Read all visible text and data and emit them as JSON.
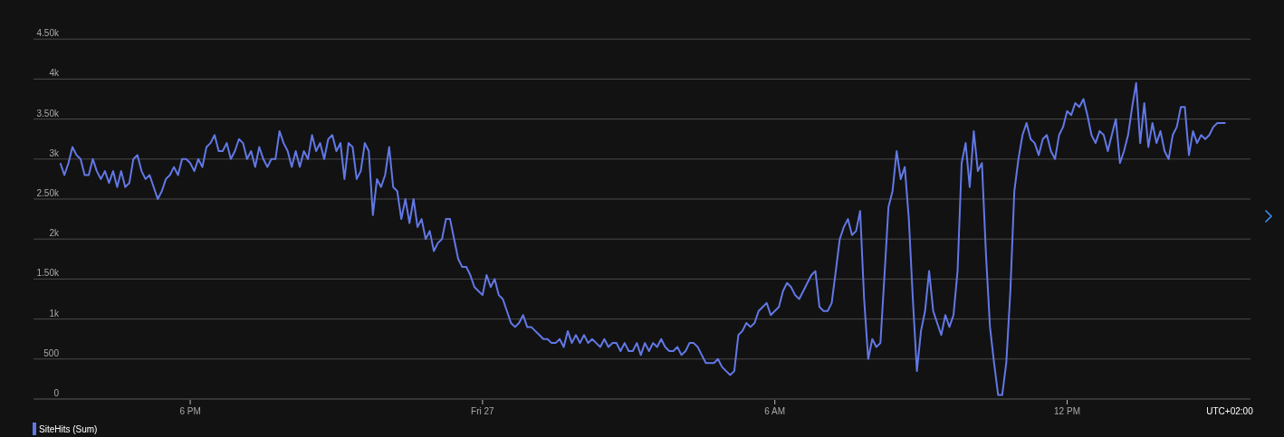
{
  "chart": {
    "timezone": "UTC+02:00",
    "chart_data": {
      "type": "line",
      "categories": [
        null,
        null,
        null,
        null,
        null,
        null,
        null,
        null,
        null,
        null,
        null,
        null,
        null,
        null,
        null,
        null,
        null,
        null,
        null,
        null,
        null,
        null,
        null,
        null,
        null,
        null,
        null,
        null,
        null,
        null,
        null,
        null,
        "6 PM",
        null,
        null,
        null,
        null,
        null,
        null,
        null,
        null,
        null,
        null,
        null,
        null,
        null,
        null,
        null,
        null,
        null,
        null,
        null,
        null,
        null,
        null,
        null,
        null,
        null,
        null,
        null,
        null,
        null,
        null,
        null,
        null,
        null,
        null,
        null,
        null,
        null,
        null,
        null,
        null,
        null,
        null,
        null,
        null,
        null,
        null,
        null,
        null,
        null,
        null,
        null,
        null,
        null,
        null,
        null,
        null,
        null,
        null,
        null,
        null,
        null,
        null,
        null,
        null,
        null,
        null,
        null,
        null,
        null,
        null,
        null,
        "Fri 27",
        null,
        null,
        null,
        null,
        null,
        null,
        null,
        null,
        null,
        null,
        null,
        null,
        null,
        null,
        null,
        null,
        null,
        null,
        null,
        null,
        null,
        null,
        null,
        null,
        null,
        null,
        null,
        null,
        null,
        null,
        null,
        null,
        null,
        null,
        null,
        null,
        null,
        null,
        null,
        null,
        null,
        null,
        null,
        null,
        null,
        null,
        null,
        null,
        null,
        null,
        null,
        null,
        null,
        null,
        null,
        null,
        null,
        null,
        null,
        null,
        null,
        null,
        null,
        null,
        null,
        null,
        null,
        null,
        null,
        null,
        null,
        "6 AM",
        null,
        null,
        null,
        null,
        null,
        null,
        null,
        null,
        null,
        null,
        null,
        null,
        null,
        null,
        null,
        null,
        null,
        null,
        null,
        null,
        null,
        null,
        null,
        null,
        null,
        null,
        null,
        null,
        null,
        null,
        null,
        null,
        null,
        null,
        null,
        null,
        null,
        null,
        null,
        null,
        null,
        null,
        null,
        null,
        null,
        null,
        null,
        null,
        null,
        null,
        null,
        null,
        null,
        null,
        null,
        null,
        null,
        null,
        null,
        null,
        null,
        null,
        null,
        null,
        null,
        null,
        null,
        null,
        null,
        null,
        null,
        "12 PM",
        null,
        null,
        null,
        null,
        null,
        null,
        null,
        null,
        null,
        null,
        null,
        null,
        null,
        null,
        null,
        null,
        null,
        null,
        null,
        null,
        null,
        null,
        null,
        null,
        null,
        null,
        null,
        null,
        null,
        null,
        null,
        null,
        null,
        null,
        null,
        null,
        null,
        null,
        null
      ],
      "series": [
        {
          "name": "SiteHits (Sum)",
          "color": "#6278e6",
          "values": [
            2950,
            2800,
            2950,
            3150,
            3050,
            3000,
            2800,
            2800,
            3000,
            2850,
            2750,
            2850,
            2700,
            2850,
            2650,
            2850,
            2650,
            2700,
            3000,
            3050,
            2850,
            2750,
            2800,
            2650,
            2500,
            2600,
            2750,
            2800,
            2900,
            2800,
            3000,
            3000,
            2950,
            2850,
            3000,
            2900,
            3150,
            3200,
            3300,
            3100,
            3100,
            3200,
            3000,
            3100,
            3250,
            3200,
            3000,
            3100,
            2900,
            3150,
            3000,
            2900,
            3000,
            3000,
            3350,
            3200,
            3100,
            2900,
            3100,
            2900,
            3100,
            3000,
            3300,
            3100,
            3200,
            3000,
            3250,
            3300,
            3100,
            3200,
            2750,
            3200,
            3150,
            2750,
            2850,
            3200,
            3100,
            2300,
            2750,
            2650,
            2800,
            3150,
            2650,
            2600,
            2250,
            2500,
            2200,
            2500,
            2150,
            2250,
            2000,
            2100,
            1850,
            1950,
            2000,
            2250,
            2250,
            2000,
            1750,
            1650,
            1650,
            1550,
            1400,
            1350,
            1300,
            1550,
            1400,
            1500,
            1300,
            1250,
            1100,
            950,
            900,
            950,
            1050,
            900,
            900,
            850,
            800,
            750,
            750,
            700,
            700,
            750,
            650,
            850,
            700,
            800,
            700,
            800,
            700,
            750,
            700,
            650,
            750,
            650,
            700,
            700,
            600,
            700,
            600,
            600,
            700,
            550,
            700,
            600,
            700,
            650,
            750,
            650,
            600,
            600,
            650,
            550,
            600,
            700,
            700,
            650,
            550,
            450,
            450,
            450,
            500,
            400,
            350,
            300,
            350,
            800,
            850,
            950,
            900,
            950,
            1100,
            1150,
            1200,
            1050,
            1100,
            1150,
            1350,
            1450,
            1400,
            1300,
            1250,
            1350,
            1450,
            1550,
            1600,
            1150,
            1100,
            1100,
            1200,
            1600,
            2000,
            2150,
            2250,
            2050,
            2100,
            2350,
            1250,
            500,
            750,
            650,
            700,
            1550,
            2400,
            2600,
            3100,
            2750,
            2900,
            2250,
            1250,
            350,
            850,
            1100,
            1600,
            1100,
            950,
            800,
            1050,
            900,
            1050,
            1600,
            2950,
            3200,
            2650,
            3350,
            2850,
            2950,
            1800,
            900,
            450,
            50,
            50,
            450,
            1350,
            2600,
            3000,
            3300,
            3450,
            3250,
            3200,
            3050,
            3250,
            3300,
            3100,
            3000,
            3300,
            3400,
            3600,
            3550,
            3700,
            3650,
            3750,
            3550,
            3300,
            3200,
            3350,
            3300,
            3100,
            3300,
            3500,
            2950,
            3100,
            3300,
            3650,
            3950,
            3200,
            3700,
            3150,
            3450,
            3200,
            3350,
            3100,
            3000,
            3300,
            3400,
            3650,
            3650,
            3050,
            3350,
            3200,
            3300,
            3250,
            3300,
            3400,
            3450,
            3450,
            3450
          ]
        }
      ],
      "ylim": [
        0,
        4500
      ],
      "grid": true,
      "yticks": [
        {
          "value": 0,
          "label": "0"
        },
        {
          "value": 500,
          "label": "500"
        },
        {
          "value": 1000,
          "label": "1k"
        },
        {
          "value": 1500,
          "label": "1.50k"
        },
        {
          "value": 2000,
          "label": "2k"
        },
        {
          "value": 2500,
          "label": "2.50k"
        },
        {
          "value": 3000,
          "label": "3k"
        },
        {
          "value": 3500,
          "label": "3.50k"
        },
        {
          "value": 4000,
          "label": "4k"
        },
        {
          "value": 4500,
          "label": "4.50k"
        }
      ]
    }
  }
}
